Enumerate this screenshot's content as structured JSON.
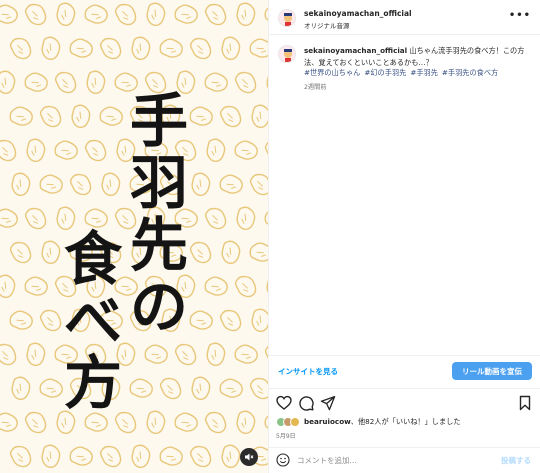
{
  "media": {
    "title_col_1": [
      "手",
      "羽",
      "先",
      "の"
    ],
    "title_col_2": [
      "食",
      "べ",
      "方"
    ],
    "mute_icon": "speaker-muted-icon",
    "bg_color": "#fdf9ef",
    "pattern_color": "#e8c77a"
  },
  "header": {
    "username": "sekainoyamachan_official",
    "audio": "オリジナル音源",
    "more_icon": "more-horizontal-icon"
  },
  "caption": {
    "username": "sekainoyamachan_official",
    "text": "山ちゃん流手羽先の食べ方！この方法、覚えておくといいことあるかも…？",
    "hashtags": [
      "#世界の山ちゃん",
      "#幻の手羽先",
      "#手羽先",
      "#手羽先の食べ方"
    ],
    "time_ago": "2週間前"
  },
  "insight": {
    "link": "インサイトを見る",
    "promote": "リール動画を宣伝"
  },
  "actions": {
    "icons": [
      "heart-icon",
      "comment-icon",
      "share-icon",
      "bookmark-icon"
    ],
    "likes_user": "bearuiocow",
    "likes_rest": "、他82人が「いいね！」しました",
    "date": "5月9日"
  },
  "comment": {
    "placeholder": "コメントを追加...",
    "post": "投稿する"
  },
  "colors": {
    "accent": "#0095f6",
    "promote_bg": "#4ca0f0"
  }
}
